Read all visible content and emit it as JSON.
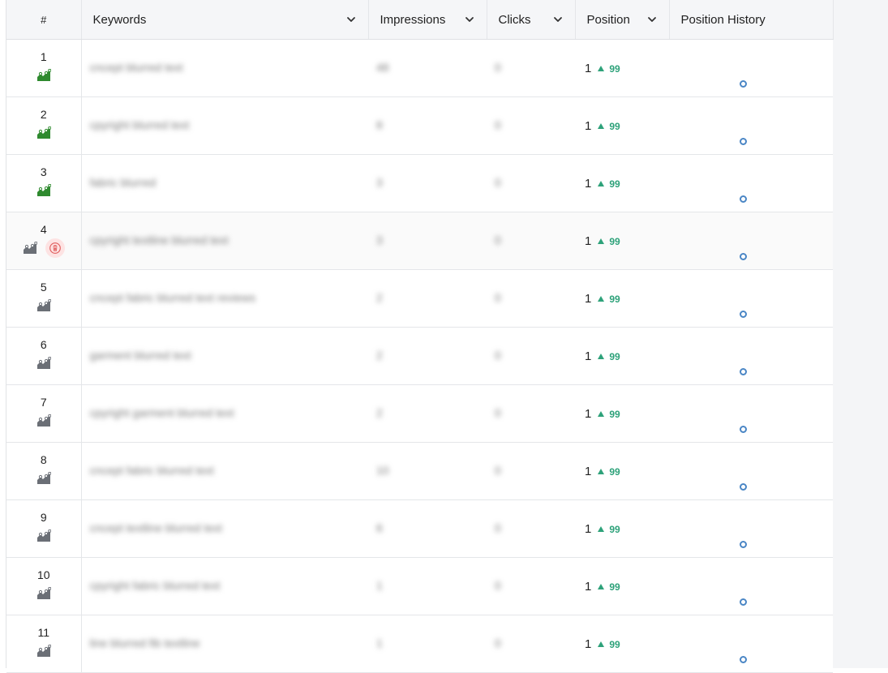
{
  "colors": {
    "accent_green": "#2ea27a",
    "trend_green": "#2f8a2f",
    "trend_gray": "#6b6f76",
    "delete_red": "#e05c5c",
    "history_dot": "#4a86c5"
  },
  "header": {
    "hash": "#",
    "keywords": "Keywords",
    "impressions": "Impressions",
    "clicks": "Clicks",
    "position": "Position",
    "history": "Position History"
  },
  "rows": [
    {
      "n": "1",
      "trend": "green",
      "kw": "cncept blurred text",
      "imp": "48",
      "clk": "0",
      "pos": "1",
      "delta": "99"
    },
    {
      "n": "2",
      "trend": "green",
      "kw": "cpyright blurred text",
      "imp": "8",
      "clk": "0",
      "pos": "1",
      "delta": "99"
    },
    {
      "n": "3",
      "trend": "green",
      "kw": "fabric blurred",
      "imp": "3",
      "clk": "0",
      "pos": "1",
      "delta": "99"
    },
    {
      "n": "4",
      "trend": "gray",
      "kw": "cpyright textline blurred text",
      "imp": "3",
      "clk": "0",
      "pos": "1",
      "delta": "99"
    },
    {
      "n": "5",
      "trend": "gray",
      "kw": "cncept fabric blurred text reviews",
      "imp": "2",
      "clk": "0",
      "pos": "1",
      "delta": "99"
    },
    {
      "n": "6",
      "trend": "gray",
      "kw": "garment blurred text",
      "imp": "2",
      "clk": "0",
      "pos": "1",
      "delta": "99"
    },
    {
      "n": "7",
      "trend": "gray",
      "kw": "cpyright garment blurred text",
      "imp": "2",
      "clk": "0",
      "pos": "1",
      "delta": "99"
    },
    {
      "n": "8",
      "trend": "gray",
      "kw": "cncept fabric blurred text",
      "imp": "10",
      "clk": "0",
      "pos": "1",
      "delta": "99"
    },
    {
      "n": "9",
      "trend": "gray",
      "kw": "cncept textline blurred text",
      "imp": "6",
      "clk": "0",
      "pos": "1",
      "delta": "99"
    },
    {
      "n": "10",
      "trend": "gray",
      "kw": "cpyright fabric blurred text",
      "imp": "1",
      "clk": "0",
      "pos": "1",
      "delta": "99"
    },
    {
      "n": "11",
      "trend": "gray",
      "kw": "line blurred fib textline",
      "imp": "1",
      "clk": "0",
      "pos": "1",
      "delta": "99"
    }
  ]
}
